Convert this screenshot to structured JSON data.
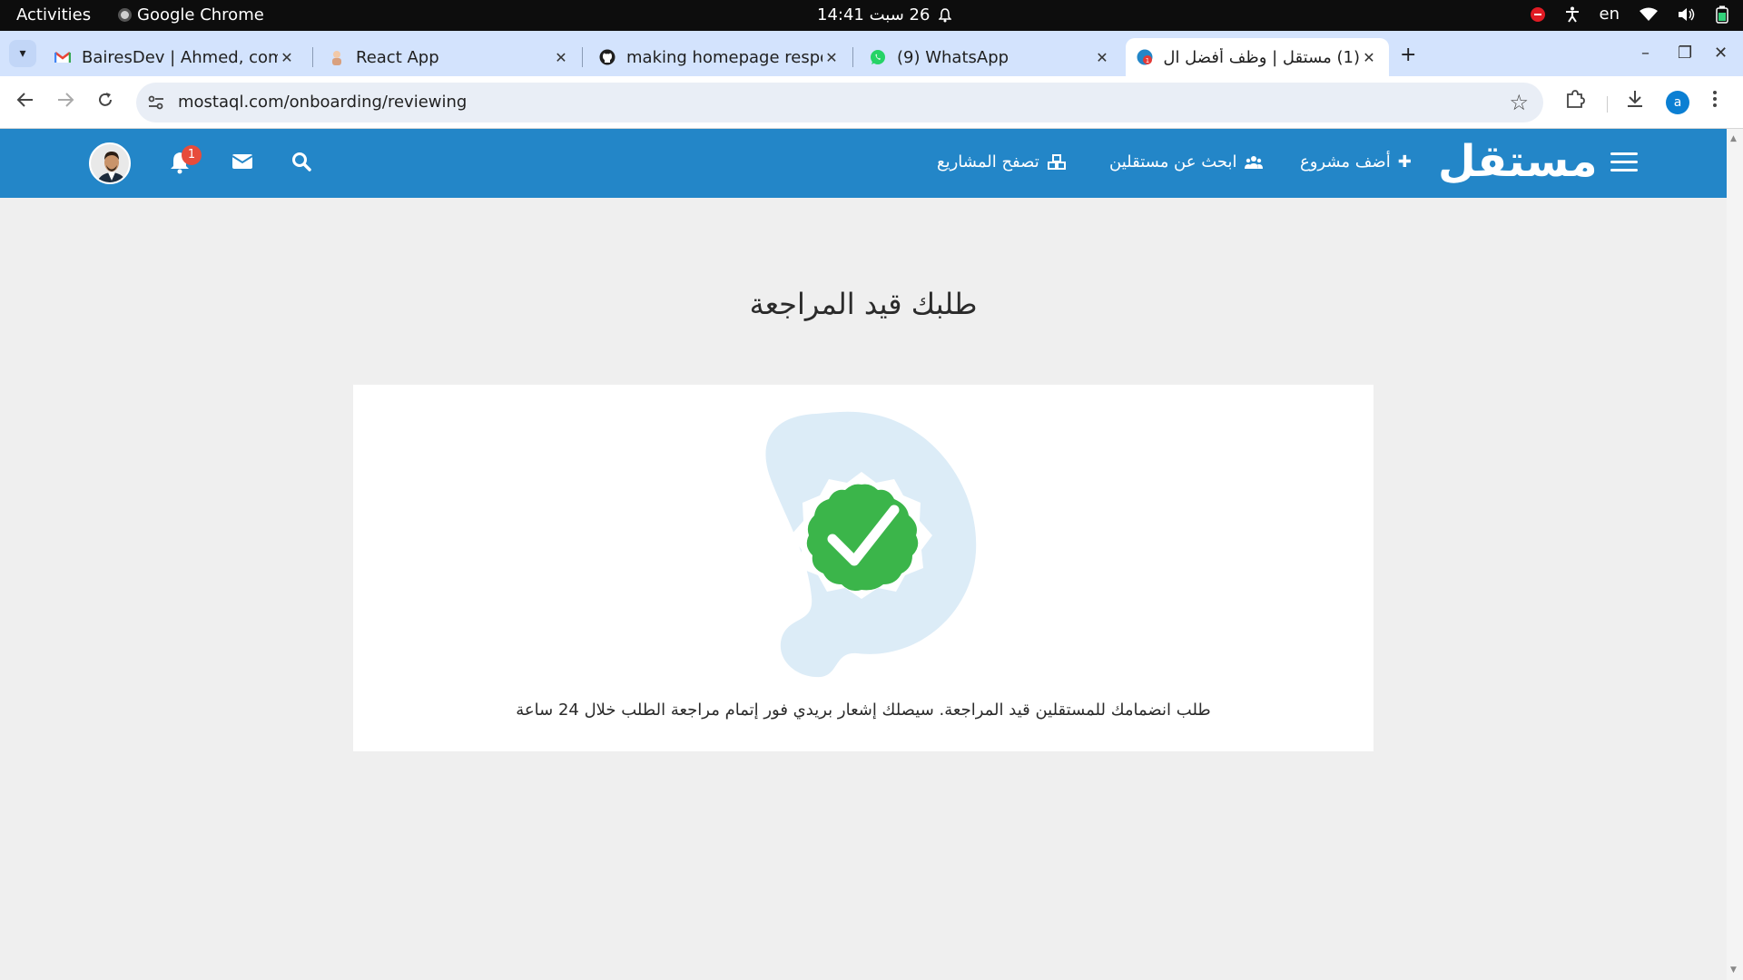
{
  "os_topbar": {
    "activities": "Activities",
    "app_name": "Google Chrome",
    "clock": "26 سبت  14:41",
    "lang": "en"
  },
  "tabs": [
    {
      "title": "BairesDev | Ahmed, com",
      "favicon": "gmail-icon"
    },
    {
      "title": "React App",
      "favicon": "react-app-icon"
    },
    {
      "title": "making homepage respo",
      "favicon": "github-icon"
    },
    {
      "title": "(9) WhatsApp",
      "favicon": "whatsapp-icon"
    },
    {
      "title": "(1) مستقل | وظف أفضل ال",
      "favicon": "mostaql-icon",
      "active": true
    }
  ],
  "omnibox": {
    "url": "mostaql.com/onboarding/reviewing",
    "profile_initial": "a"
  },
  "site": {
    "logo": "مستقل",
    "nav": {
      "add_project": "أضف مشروع",
      "find_freelancers": "ابحث عن مستقلين",
      "browse_projects": "تصفح المشاريع"
    },
    "notification_count": "1"
  },
  "main": {
    "title": "طلبك قيد المراجعة",
    "message": "طلب انضمامك للمستقلين قيد المراجعة. سيصلك إشعار بريدي فور إتمام مراجعة الطلب خلال 24 ساعة"
  },
  "colors": {
    "brand_blue": "#2386c8",
    "success_green": "#3bb54a",
    "blob_light_blue": "#dcecf7",
    "badge_red": "#e74c3c"
  }
}
